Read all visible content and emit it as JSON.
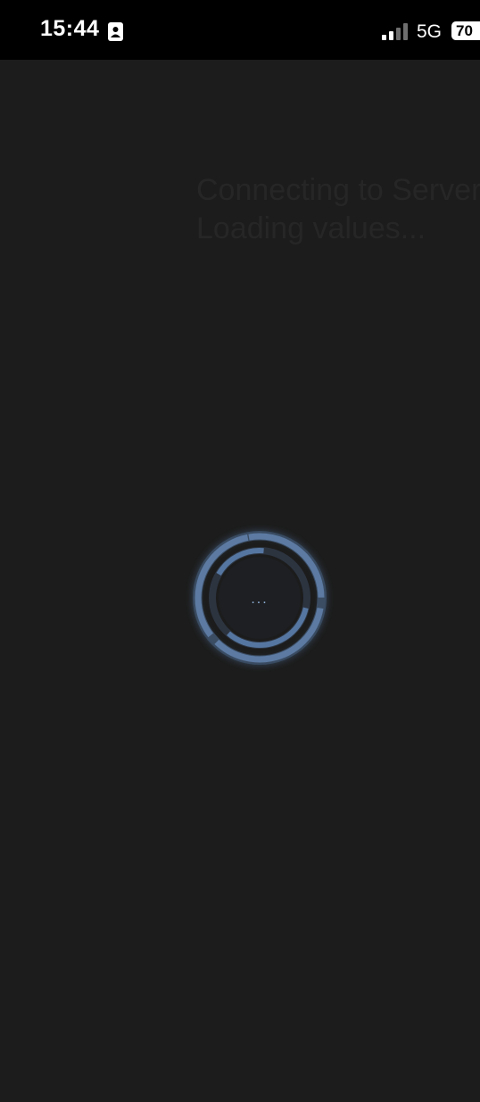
{
  "status_bar": {
    "time": "15:44",
    "network": "5G",
    "battery_level": "70",
    "icons": [
      "contact-card-icon",
      "signal-icon"
    ]
  },
  "loading": {
    "line1": "Connecting to Server",
    "line2": "Loading values...",
    "spinner_text": "...",
    "accent_color": "#5a7aa5"
  }
}
